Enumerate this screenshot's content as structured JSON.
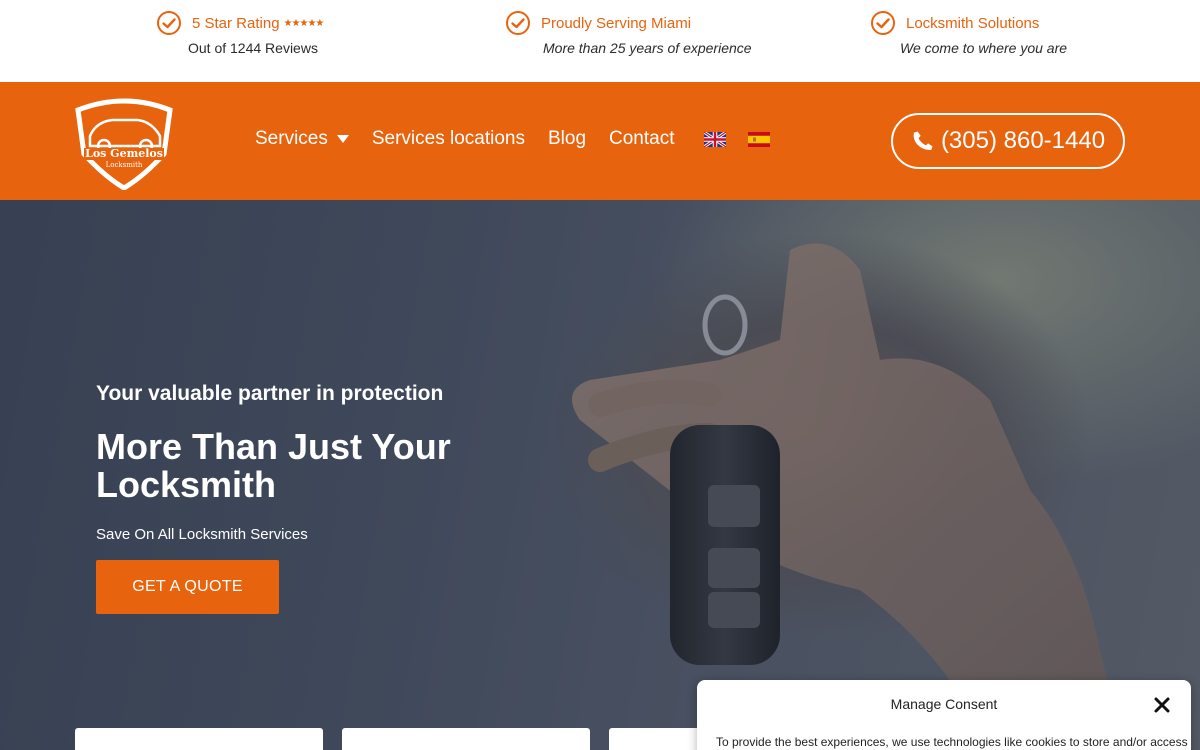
{
  "topbar": {
    "rating": {
      "title": "5 Star Rating",
      "stars": "★★★★★",
      "sub": "Out of 1244 Reviews"
    },
    "serving": {
      "title": "Proudly Serving Miami",
      "sub": "More than 25 years of experience"
    },
    "solutions": {
      "title": "Locksmith Solutions",
      "sub": "We come to where you are"
    }
  },
  "logo": {
    "name": "Los Gemelos",
    "tagline": "Locksmith"
  },
  "nav": {
    "items": [
      {
        "label": "Services"
      },
      {
        "label": "Services locations"
      },
      {
        "label": "Blog"
      },
      {
        "label": "Contact"
      }
    ]
  },
  "phone": {
    "number": "(305) 860-1440"
  },
  "hero": {
    "tagline": "Your valuable partner in protection",
    "headline": "More Than Just Your Locksmith",
    "lead": "Save On All Locksmith Services",
    "cta": "GET A QUOTE"
  },
  "consent": {
    "title": "Manage Consent",
    "text": "To provide the best experiences, we use technologies like cookies to store and/or access"
  },
  "colors": {
    "brand": "#e8630e",
    "text": "#2b2b2b",
    "white": "#ffffff"
  }
}
